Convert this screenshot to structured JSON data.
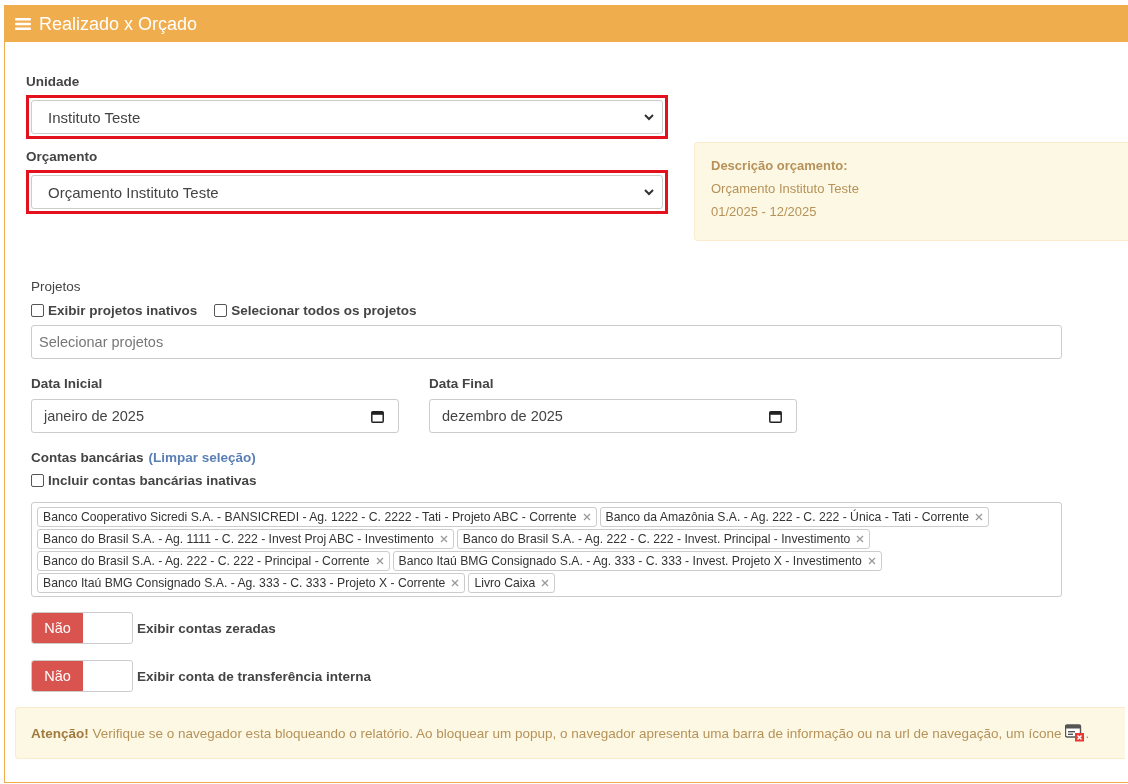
{
  "panel": {
    "title": "Realizado x Orçado"
  },
  "unidade": {
    "label": "Unidade",
    "value": "Instituto Teste",
    "highlighted": true
  },
  "orcamento": {
    "label": "Orçamento",
    "value": "Orçamento Instituto Teste",
    "highlighted": true
  },
  "descricao": {
    "title": "Descrição orçamento:",
    "lines": [
      "Orçamento Instituto Teste",
      "01/2025 - 12/2025"
    ]
  },
  "projetos": {
    "label": "Projetos",
    "checkboxes": [
      {
        "label": "Exibir projetos inativos",
        "checked": false
      },
      {
        "label": "Selecionar todos os projetos",
        "checked": false
      }
    ],
    "placeholder": "Selecionar projetos"
  },
  "dates": [
    {
      "label": "Data Inicial",
      "value": "janeiro de 2025"
    },
    {
      "label": "Data Final",
      "value": "dezembro de 2025"
    }
  ],
  "contas": {
    "label": "Contas bancárias",
    "link": "(Limpar seleção)",
    "checkbox": {
      "label": "Incluir contas bancárias inativas",
      "checked": false
    },
    "tags": [
      "Banco Cooperativo Sicredi S.A. - BANSICREDI - Ag. 1222 - C. 2222 - Tati - Projeto ABC - Corrente",
      "Banco da Amazônia S.A. - Ag. 222 - C. 222 - Única - Tati - Corrente",
      "Banco do Brasil S.A. - Ag. 1111 - C. 222 - Invest Proj ABC - Investimento",
      "Banco do Brasil S.A. - Ag. 222 - C. 222 - Invest. Principal - Investimento",
      "Banco do Brasil S.A. - Ag. 222 - C. 222 - Principal - Corrente",
      "Banco Itaú BMG Consignado S.A. - Ag. 333 - C. 333 - Invest. Projeto X - Investimento",
      "Banco Itaú BMG Consignado S.A. - Ag. 333 - C. 333 - Projeto X - Corrente",
      "Livro Caixa"
    ]
  },
  "toggles": [
    {
      "state": "Não",
      "on": false,
      "label": "Exibir contas zeradas"
    },
    {
      "state": "Não",
      "on": false,
      "label": "Exibir conta de transferência interna"
    }
  ],
  "alert": {
    "text": "**Atenção!** Verifique se o navegador esta bloqueando o relatório. Ao bloquear um popup, o navegador apresenta uma barra de informação ou na url de navegação, um ícone",
    "suffix": "."
  }
}
